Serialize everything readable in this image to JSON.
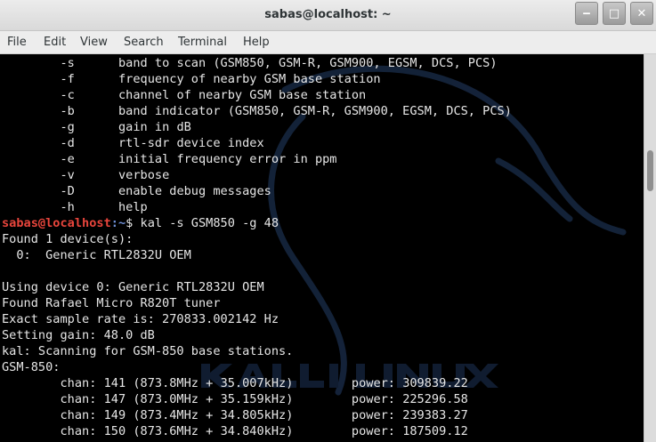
{
  "window": {
    "title": "sabas@localhost: ~",
    "minimize_glyph": "‒",
    "maximize_glyph": "□",
    "close_glyph": "✕"
  },
  "menu": [
    "File",
    "Edit",
    "View",
    "Search",
    "Terminal",
    "Help"
  ],
  "terminal": {
    "help_options": [
      {
        "flag": "-s",
        "desc": "band to scan (GSM850, GSM-R, GSM900, EGSM, DCS, PCS)"
      },
      {
        "flag": "-f",
        "desc": "frequency of nearby GSM base station"
      },
      {
        "flag": "-c",
        "desc": "channel of nearby GSM base station"
      },
      {
        "flag": "-b",
        "desc": "band indicator (GSM850, GSM-R, GSM900, EGSM, DCS, PCS)"
      },
      {
        "flag": "-g",
        "desc": "gain in dB"
      },
      {
        "flag": "-d",
        "desc": "rtl-sdr device index"
      },
      {
        "flag": "-e",
        "desc": "initial frequency error in ppm"
      },
      {
        "flag": "-v",
        "desc": "verbose"
      },
      {
        "flag": "-D",
        "desc": "enable debug messages"
      },
      {
        "flag": "-h",
        "desc": "help"
      }
    ],
    "prompt": {
      "user_host": "sabas@localhost",
      "path": ":~",
      "symbol": "$",
      "command": "kal -s GSM850 -g 48"
    },
    "output": [
      "Found 1 device(s):",
      "  0:  Generic RTL2832U OEM",
      "",
      "Using device 0: Generic RTL2832U OEM",
      "Found Rafael Micro R820T tuner",
      "Exact sample rate is: 270833.002142 Hz",
      "Setting gain: 48.0 dB",
      "kal: Scanning for GSM-850 base stations.",
      "GSM-850:"
    ],
    "channels": [
      {
        "chan": "141",
        "freq": "873.8MHz",
        "offset": "35.007kHz",
        "power": "309839.22"
      },
      {
        "chan": "147",
        "freq": "873.0MHz",
        "offset": "35.159kHz",
        "power": "225296.58"
      },
      {
        "chan": "149",
        "freq": "873.4MHz",
        "offset": "34.805kHz",
        "power": "239383.27"
      },
      {
        "chan": "150",
        "freq": "873.6MHz",
        "offset": "34.840kHz",
        "power": "187509.12"
      }
    ]
  },
  "colors": {
    "terminal_bg": "#000000",
    "terminal_fg": "#e6e6e6",
    "prompt_user": "#e8453c",
    "prompt_path": "#6f8fd6"
  }
}
